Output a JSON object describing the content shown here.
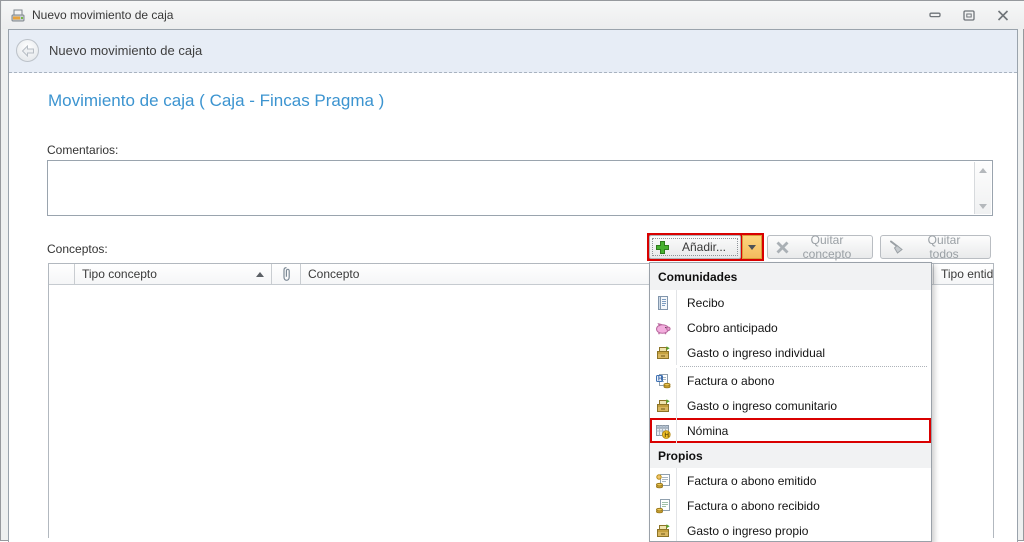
{
  "window": {
    "title": "Nuevo movimiento de caja",
    "controls": [
      "minimize",
      "maximize",
      "close"
    ]
  },
  "nav": {
    "title": "Nuevo movimiento de caja"
  },
  "page": {
    "title": "Movimiento de caja ( Caja - Fincas Pragma )"
  },
  "form": {
    "comments_label": "Comentarios:",
    "comments_value": "",
    "concepts_label": "Conceptos:"
  },
  "toolbar": {
    "add_label": "Añadir...",
    "add_highlighted": true,
    "remove_label": "Quitar concepto",
    "remove_all_label": "Quitar todos",
    "remove_enabled": false,
    "remove_all_enabled": false
  },
  "table": {
    "columns": [
      {
        "label": "",
        "name": "row-indicator"
      },
      {
        "label": "Tipo concepto",
        "sort": "asc"
      },
      {
        "label": "",
        "name": "attachment"
      },
      {
        "label": "Concepto"
      },
      {
        "label": "Tipo entida"
      }
    ],
    "rows": []
  },
  "menu": {
    "sections": [
      {
        "header": "Comunidades",
        "items": [
          {
            "label": "Recibo",
            "icon": "receipt-icon"
          },
          {
            "label": "Cobro anticipado",
            "icon": "piggy-bank-icon"
          },
          {
            "label": "Gasto o ingreso individual",
            "icon": "cashbox-icon"
          },
          {
            "label": "Factura o abono",
            "icon": "invoice-h-icon"
          },
          {
            "label": "Gasto o ingreso comunitario",
            "icon": "cashbox-icon"
          },
          {
            "label": "Nómina",
            "icon": "payroll-grid-icon",
            "highlighted": true
          }
        ]
      },
      {
        "header": "Propios",
        "items": [
          {
            "label": "Factura o abono emitido",
            "icon": "invoice-sent-icon"
          },
          {
            "label": "Factura o abono recibido",
            "icon": "invoice-received-icon"
          },
          {
            "label": "Gasto o ingreso propio",
            "icon": "cashbox-icon"
          }
        ]
      }
    ]
  },
  "colors": {
    "highlight_red": "#d90000",
    "page_title_blue": "#3c94d0",
    "nav_band_blue": "#e7edf6",
    "dropdown_amber": "#f4bb5e"
  }
}
